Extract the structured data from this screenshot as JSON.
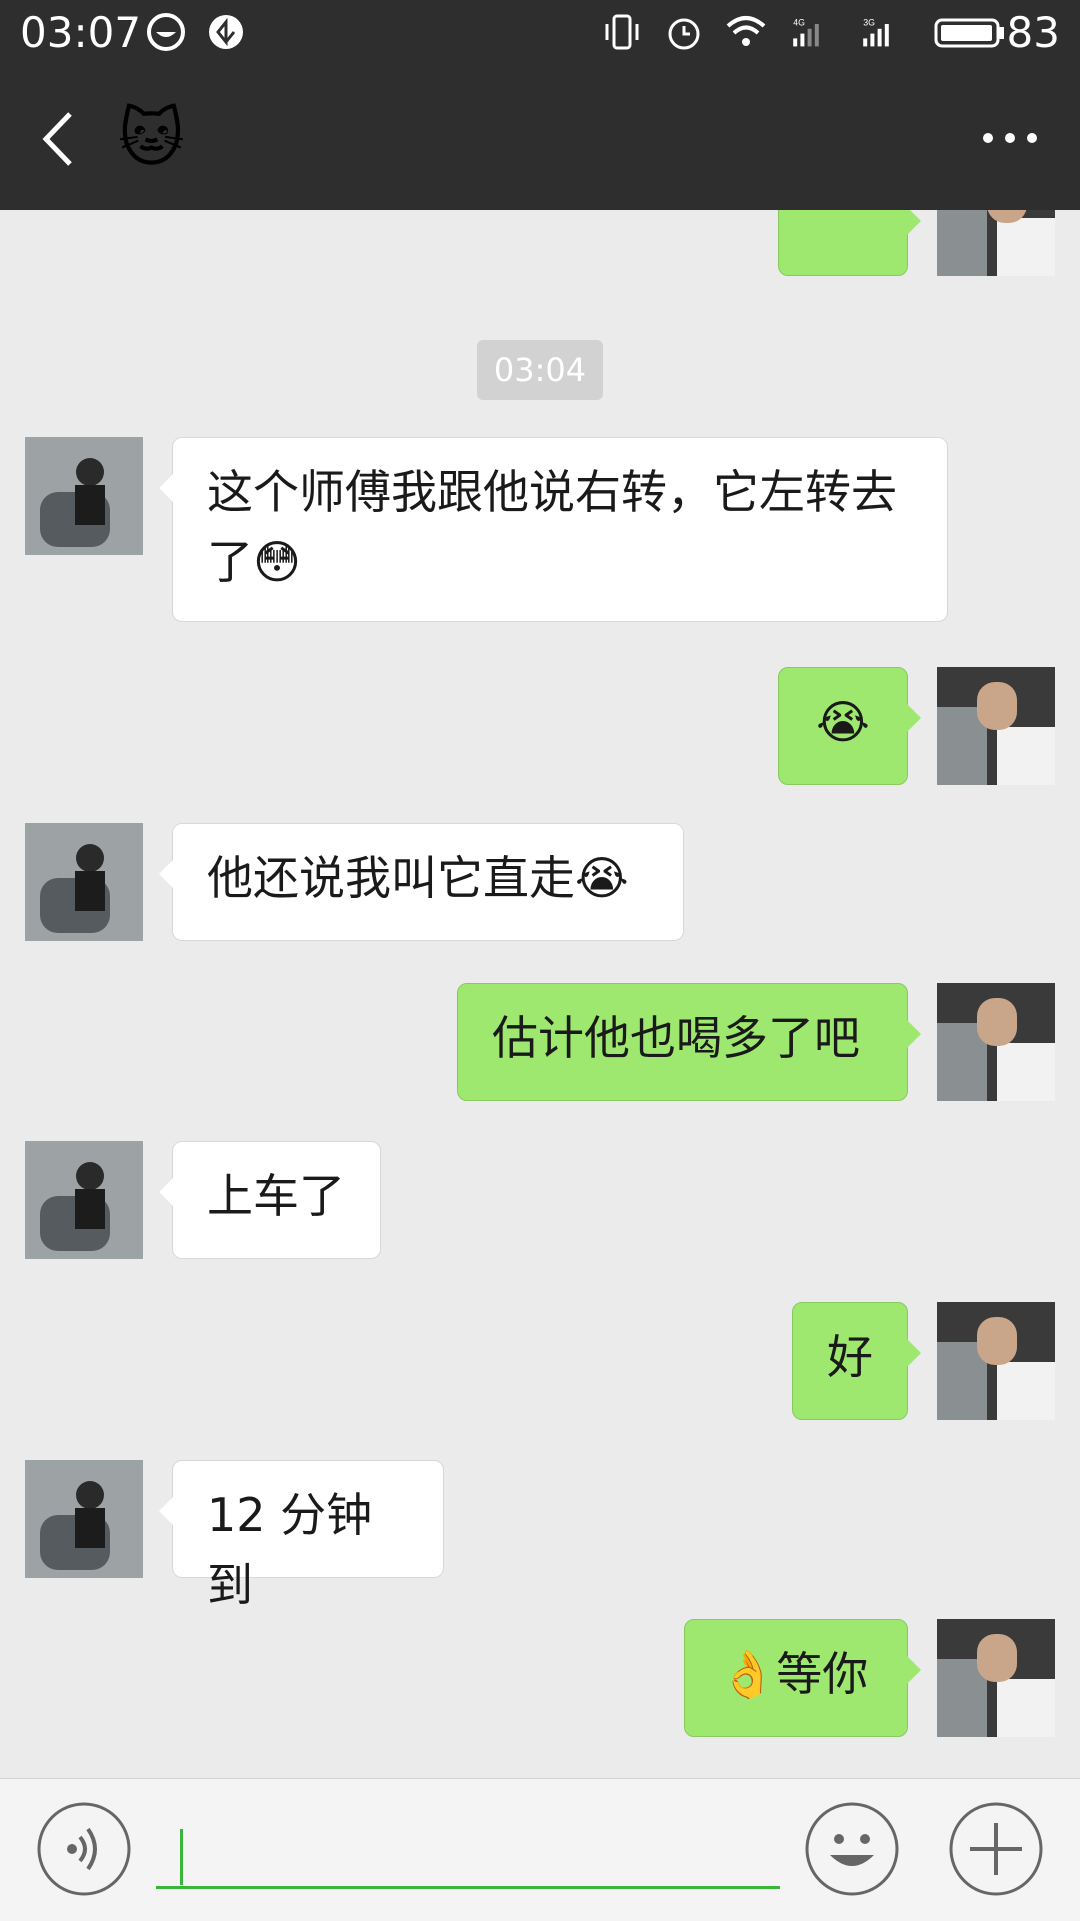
{
  "status_bar": {
    "time": "03:07",
    "network_1": "4G",
    "network_2": "3G",
    "battery": "83"
  },
  "nav": {
    "title": "🐱",
    "back_icon": "chevron-left-icon",
    "more_icon": "more-horizontal-icon"
  },
  "chat": {
    "timestamp": "03:04",
    "messages": [
      {
        "side": "left",
        "text": "这个师傅我跟他说右转，它左转去了😳"
      },
      {
        "side": "right",
        "text": "😭"
      },
      {
        "side": "left",
        "text": "他还说我叫它直走😭"
      },
      {
        "side": "right",
        "text": "估计他也喝多了吧"
      },
      {
        "side": "left",
        "text": "上车了"
      },
      {
        "side": "right",
        "text": "好"
      },
      {
        "side": "left",
        "text": "12 分钟到"
      },
      {
        "side": "right",
        "text": "👌等你"
      }
    ]
  },
  "input": {
    "value": "",
    "voice_icon": "voice-icon",
    "emoji_icon": "emoji-icon",
    "plus_icon": "plus-icon"
  },
  "colors": {
    "bar_bg": "#2e2e2e",
    "chat_bg": "#ebebeb",
    "sent_bubble": "#9ee870",
    "received_bubble": "#ffffff",
    "accent": "#3ab53a"
  }
}
